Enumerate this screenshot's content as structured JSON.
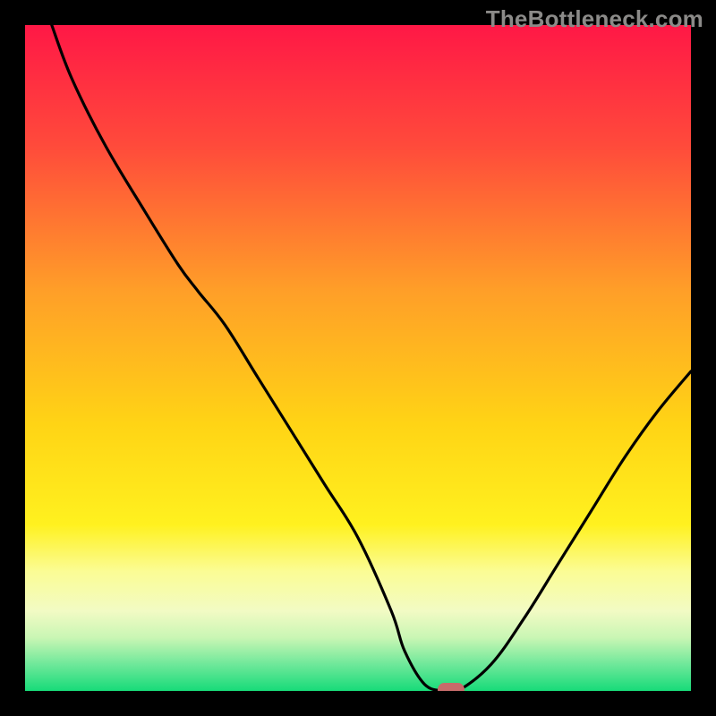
{
  "watermark_text": "TheBottleneck.com",
  "chart_data": {
    "type": "line",
    "title": "",
    "xlabel": "",
    "ylabel": "",
    "axes_visible": false,
    "background": "red-to-green vertical gradient (bottleneck heatmap)",
    "x_range": [
      0,
      100
    ],
    "y_range": [
      0,
      100
    ],
    "series": [
      {
        "name": "bottleneck-curve",
        "x": [
          4,
          7,
          12,
          18,
          23,
          26,
          30,
          35,
          40,
          45,
          50,
          55,
          57,
          60,
          63,
          65,
          70,
          75,
          80,
          85,
          90,
          95,
          100
        ],
        "y": [
          100,
          92,
          82,
          72,
          64,
          60,
          55,
          47,
          39,
          31,
          23,
          12,
          6,
          1,
          0,
          0,
          4,
          11,
          19,
          27,
          35,
          42,
          48
        ]
      }
    ],
    "marker": {
      "x": 64,
      "y": 0,
      "color": "#c76b6a"
    },
    "gradient_stops": [
      {
        "pct": 0,
        "color": "#ff1846"
      },
      {
        "pct": 18,
        "color": "#ff4a3b"
      },
      {
        "pct": 40,
        "color": "#ff9f28"
      },
      {
        "pct": 60,
        "color": "#ffd415"
      },
      {
        "pct": 75,
        "color": "#fff11f"
      },
      {
        "pct": 82,
        "color": "#fbfc94"
      },
      {
        "pct": 88,
        "color": "#f2fbc4"
      },
      {
        "pct": 92,
        "color": "#c9f6b4"
      },
      {
        "pct": 96,
        "color": "#6fe89a"
      },
      {
        "pct": 100,
        "color": "#17db79"
      }
    ]
  }
}
